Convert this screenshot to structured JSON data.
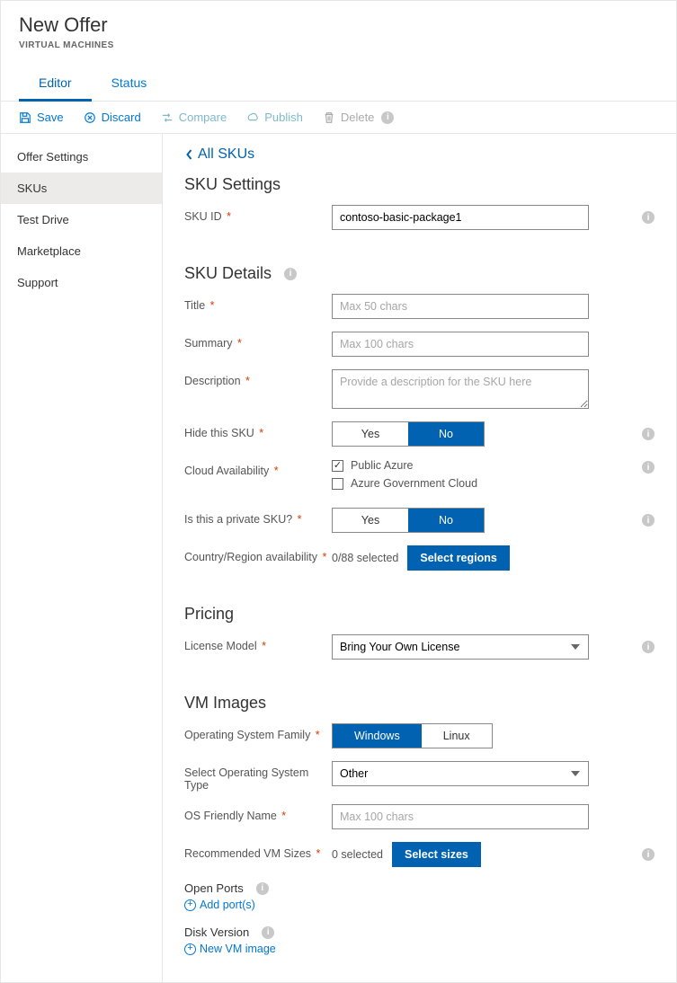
{
  "header": {
    "title": "New Offer",
    "subtitle": "VIRTUAL MACHINES"
  },
  "tabs": {
    "editor": "Editor",
    "status": "Status"
  },
  "toolbar": {
    "save": "Save",
    "discard": "Discard",
    "compare": "Compare",
    "publish": "Publish",
    "delete": "Delete"
  },
  "sidebar": {
    "offer_settings": "Offer Settings",
    "skus": "SKUs",
    "test_drive": "Test Drive",
    "marketplace": "Marketplace",
    "support": "Support"
  },
  "back_link": "All SKUs",
  "sku_settings": {
    "heading": "SKU Settings",
    "sku_id": {
      "label": "SKU ID",
      "value": "contoso-basic-package1"
    }
  },
  "sku_details": {
    "heading": "SKU Details",
    "title": {
      "label": "Title",
      "placeholder": "Max 50 chars"
    },
    "summary": {
      "label": "Summary",
      "placeholder": "Max 100 chars"
    },
    "description": {
      "label": "Description",
      "placeholder": "Provide a description for the SKU here"
    },
    "hide": {
      "label": "Hide this SKU",
      "yes": "Yes",
      "no": "No"
    },
    "cloud": {
      "label": "Cloud Availability",
      "public": "Public Azure",
      "gov": "Azure Government Cloud"
    },
    "private": {
      "label": "Is this a private SKU?",
      "yes": "Yes",
      "no": "No"
    },
    "region": {
      "label": "Country/Region availability",
      "status": "0/88 selected",
      "button": "Select regions"
    }
  },
  "pricing": {
    "heading": "Pricing",
    "license": {
      "label": "License Model",
      "value": "Bring Your Own License"
    }
  },
  "vm": {
    "heading": "VM Images",
    "osfam": {
      "label": "Operating System Family",
      "windows": "Windows",
      "linux": "Linux"
    },
    "ostype": {
      "label": "Select Operating System Type",
      "value": "Other"
    },
    "osname": {
      "label": "OS Friendly Name",
      "placeholder": "Max 100 chars"
    },
    "sizes": {
      "label": "Recommended VM Sizes",
      "status": "0 selected",
      "button": "Select sizes"
    },
    "ports": {
      "heading": "Open Ports",
      "action": "Add port(s)"
    },
    "disk": {
      "heading": "Disk Version",
      "action": "New VM image"
    }
  }
}
